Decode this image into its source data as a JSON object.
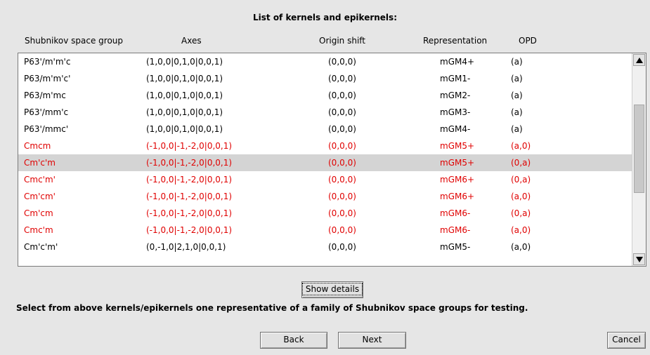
{
  "title": "List of kernels and epikernels:",
  "columns": [
    "Shubnikov space group",
    "Axes",
    "Origin shift",
    "Representation",
    "OPD"
  ],
  "rows": [
    {
      "group": "P63'/m'm'c",
      "axes": "(1,0,0|0,1,0|0,0,1)",
      "origin": "(0,0,0)",
      "rep": "mGM4+",
      "opd": "(a)",
      "red": false,
      "selected": false
    },
    {
      "group": "P63/m'm'c'",
      "axes": "(1,0,0|0,1,0|0,0,1)",
      "origin": "(0,0,0)",
      "rep": "mGM1-",
      "opd": "(a)",
      "red": false,
      "selected": false
    },
    {
      "group": "P63/m'mc",
      "axes": "(1,0,0|0,1,0|0,0,1)",
      "origin": "(0,0,0)",
      "rep": "mGM2-",
      "opd": "(a)",
      "red": false,
      "selected": false
    },
    {
      "group": "P63'/mm'c",
      "axes": "(1,0,0|0,1,0|0,0,1)",
      "origin": "(0,0,0)",
      "rep": "mGM3-",
      "opd": "(a)",
      "red": false,
      "selected": false
    },
    {
      "group": "P63'/mmc'",
      "axes": "(1,0,0|0,1,0|0,0,1)",
      "origin": "(0,0,0)",
      "rep": "mGM4-",
      "opd": "(a)",
      "red": false,
      "selected": false
    },
    {
      "group": "Cmcm",
      "axes": "(-1,0,0|-1,-2,0|0,0,1)",
      "origin": "(0,0,0)",
      "rep": "mGM5+",
      "opd": "(a,0)",
      "red": true,
      "selected": false
    },
    {
      "group": "Cm'c'm",
      "axes": "(-1,0,0|-1,-2,0|0,0,1)",
      "origin": "(0,0,0)",
      "rep": "mGM5+",
      "opd": "(0,a)",
      "red": true,
      "selected": true
    },
    {
      "group": "Cmc'm'",
      "axes": "(-1,0,0|-1,-2,0|0,0,1)",
      "origin": "(0,0,0)",
      "rep": "mGM6+",
      "opd": "(0,a)",
      "red": true,
      "selected": false
    },
    {
      "group": "Cm'cm'",
      "axes": "(-1,0,0|-1,-2,0|0,0,1)",
      "origin": "(0,0,0)",
      "rep": "mGM6+",
      "opd": "(a,0)",
      "red": true,
      "selected": false
    },
    {
      "group": "Cm'cm",
      "axes": "(-1,0,0|-1,-2,0|0,0,1)",
      "origin": "(0,0,0)",
      "rep": "mGM6-",
      "opd": "(0,a)",
      "red": true,
      "selected": false
    },
    {
      "group": "Cmc'm",
      "axes": "(-1,0,0|-1,-2,0|0,0,1)",
      "origin": "(0,0,0)",
      "rep": "mGM6-",
      "opd": "(a,0)",
      "red": true,
      "selected": false
    },
    {
      "group": "Cm'c'm'",
      "axes": "(0,-1,0|2,1,0|0,0,1)",
      "origin": "(0,0,0)",
      "rep": "mGM5-",
      "opd": "(a,0)",
      "red": false,
      "selected": false
    }
  ],
  "buttons": {
    "show_details": "Show details",
    "back": "Back",
    "next": "Next",
    "cancel": "Cancel"
  },
  "instruction": "Select from above kernels/epikernels one representative  of a family of Shubnikov space groups for testing.",
  "colors": {
    "red_text": "#e00000",
    "selected_row": "#d4d4d4",
    "background": "#e6e6e6"
  }
}
